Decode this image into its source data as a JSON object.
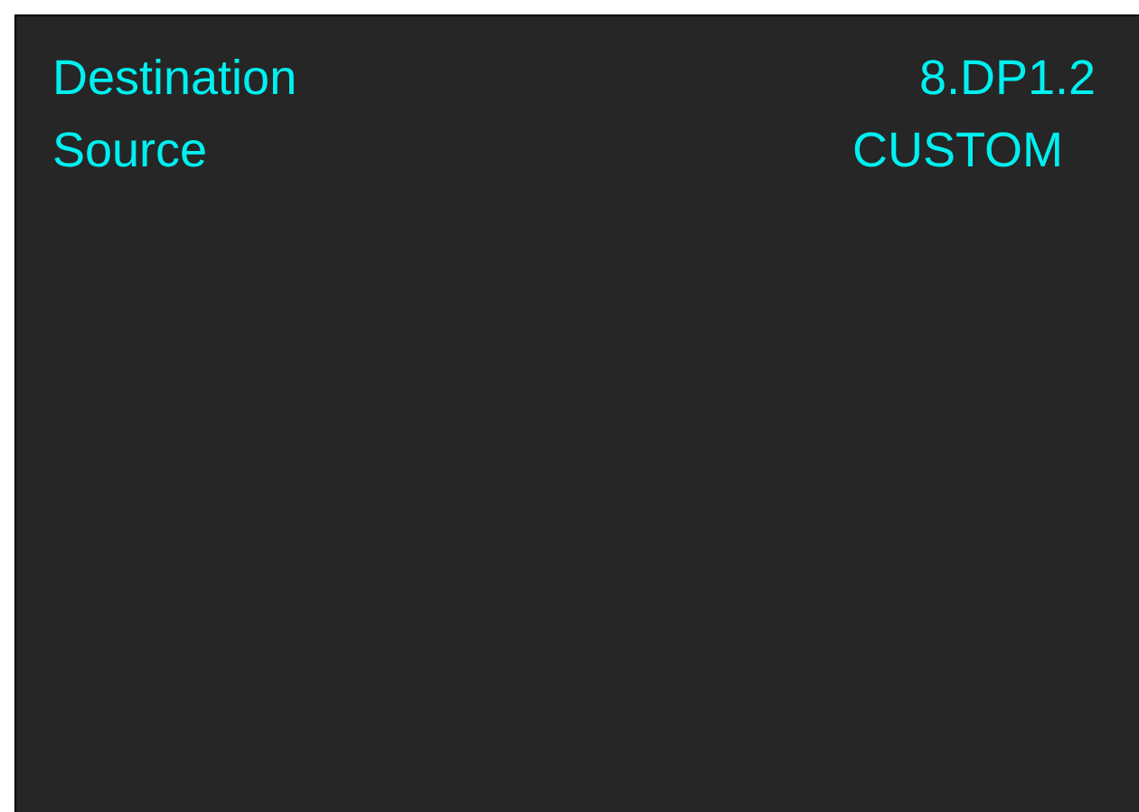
{
  "rows": [
    {
      "label": "Destination",
      "value": "8.DP1.2"
    },
    {
      "label": "Source",
      "value": "CUSTOM"
    }
  ]
}
